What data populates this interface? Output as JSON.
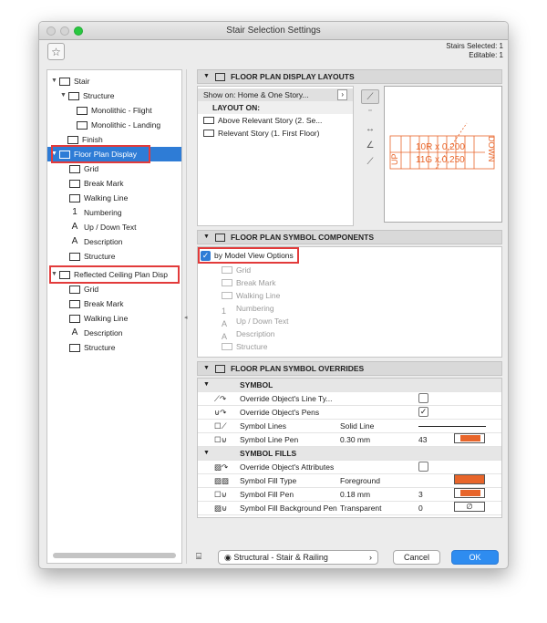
{
  "window": {
    "title": "Stair Selection Settings"
  },
  "selection": {
    "selected": "Stairs Selected: 1",
    "editable": "Editable: 1"
  },
  "tree": [
    {
      "label": "Stair",
      "icon": "stair-icon"
    },
    {
      "label": "Structure",
      "icon": "structure-icon"
    },
    {
      "label": "Monolithic - Flight",
      "icon": "flight-icon"
    },
    {
      "label": "Monolithic - Landing",
      "icon": "landing-icon"
    },
    {
      "label": "Finish",
      "icon": "finish-icon"
    },
    {
      "label": "Floor Plan Display",
      "icon": "floor-plan-icon"
    },
    {
      "label": "Grid",
      "icon": "grid-icon"
    },
    {
      "label": "Break Mark",
      "icon": "break-mark-icon"
    },
    {
      "label": "Walking Line",
      "icon": "walking-line-icon"
    },
    {
      "label": "Numbering",
      "icon": "numbering-icon"
    },
    {
      "label": "Up / Down Text",
      "icon": "up-down-text-icon"
    },
    {
      "label": "Description",
      "icon": "description-icon"
    },
    {
      "label": "Structure",
      "icon": "structure-icon"
    },
    {
      "label": "Reflected Ceiling Plan Disp",
      "icon": "ceiling-plan-icon"
    },
    {
      "label": "Grid",
      "icon": "grid-icon"
    },
    {
      "label": "Break Mark",
      "icon": "break-mark-icon"
    },
    {
      "label": "Walking Line",
      "icon": "walking-line-icon"
    },
    {
      "label": "Description",
      "icon": "description-icon"
    },
    {
      "label": "Structure",
      "icon": "structure-icon"
    }
  ],
  "layouts": {
    "header": "FLOOR PLAN DISPLAY LAYOUTS",
    "show_on": "Show on: Home & One Story...",
    "layout_on": "LAYOUT ON:",
    "rows": [
      "Above Relevant Story (2. Se...",
      "Relevant Story (1. First Floor)"
    ],
    "preview": {
      "up": "UP",
      "line1": "10R x 0,200",
      "line2": "11G x 0,250",
      "down": "DOWN",
      "color": "#e8652a"
    }
  },
  "symbols": {
    "header": "FLOOR PLAN SYMBOL COMPONENTS",
    "model_view": "by Model View Options",
    "rows": [
      "Grid",
      "Break Mark",
      "Walking Line",
      "Numbering",
      "Up / Down Text",
      "Description",
      "Structure"
    ]
  },
  "overrides": {
    "header": "FLOOR PLAN SYMBOL OVERRIDES",
    "symbol_hdr": "SYMBOL",
    "fills_hdr": "SYMBOL FILLS",
    "rows": [
      {
        "label": "Override Object's Line Ty...",
        "value": "",
        "num": "",
        "check": ""
      },
      {
        "label": "Override Object's Pens",
        "value": "",
        "num": "",
        "check": "✓"
      },
      {
        "label": "Symbol Lines",
        "value": "Solid Line",
        "num": "",
        "check": ""
      },
      {
        "label": "Symbol Line Pen",
        "value": "0.30 mm",
        "num": "43",
        "check": ""
      }
    ],
    "fill_rows": [
      {
        "label": "Override Object's Attributes",
        "value": "",
        "num": ""
      },
      {
        "label": "Symbol Fill Type",
        "value": "Foreground",
        "num": ""
      },
      {
        "label": "Symbol Fill Pen",
        "value": "0.18 mm",
        "num": "3"
      },
      {
        "label": "Symbol Fill Background Pen",
        "value": "Transparent",
        "num": "0"
      }
    ],
    "accent": "#e8652a"
  },
  "footer": {
    "view": "Structural - Stair & Railing",
    "cancel": "Cancel",
    "ok": "OK"
  }
}
